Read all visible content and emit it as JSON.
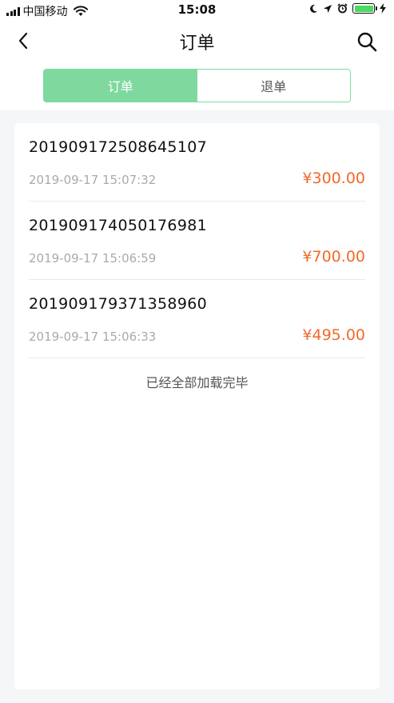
{
  "status_bar": {
    "carrier": "中国移动",
    "time": "15:08"
  },
  "nav": {
    "title": "订单"
  },
  "tabs": [
    {
      "label": "订单",
      "active": true
    },
    {
      "label": "退单",
      "active": false
    }
  ],
  "orders": [
    {
      "order_no": "201909172508645107",
      "time": "2019-09-17 15:07:32",
      "amount": "¥300.00"
    },
    {
      "order_no": "201909174050176981",
      "time": "2019-09-17 15:06:59",
      "amount": "¥700.00"
    },
    {
      "order_no": "201909179371358960",
      "time": "2019-09-17 15:06:33",
      "amount": "¥495.00"
    }
  ],
  "list_footer": "已经全部加载完毕",
  "colors": {
    "accent": "#7fd99f",
    "price": "#f26a2a",
    "battery": "#4cd964"
  },
  "icons": [
    "signal-icon",
    "wifi-icon",
    "moon-icon",
    "location-icon",
    "alarm-icon",
    "battery-icon",
    "charging-icon",
    "back-icon",
    "search-icon"
  ]
}
